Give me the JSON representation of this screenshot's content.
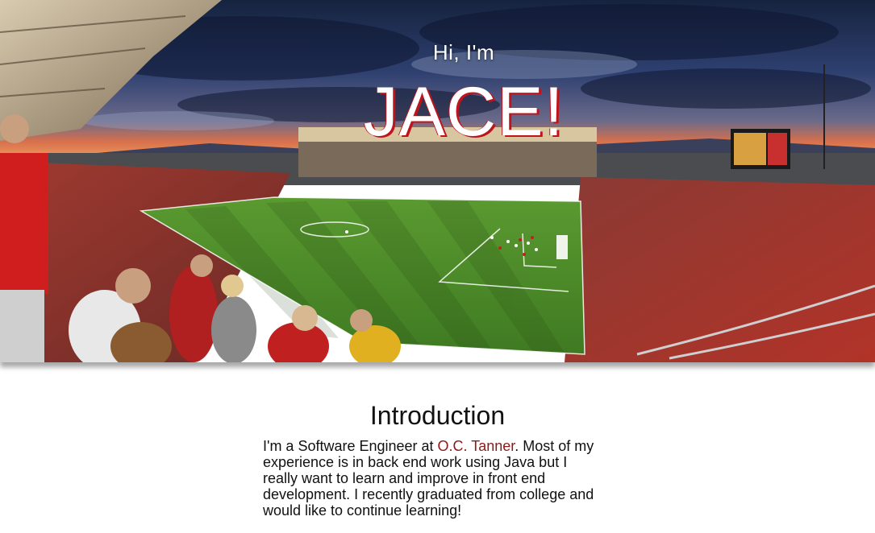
{
  "hero": {
    "greeting": "Hi, I'm",
    "name": "JACE!",
    "image_name": "stadium-panorama",
    "colors": {
      "sky_top": "#1c2a4a",
      "sunset": "#e0704a",
      "pitch": "#4f8a2c",
      "crowd": "#a4342c",
      "name_shadow": "#c0141c"
    }
  },
  "intro": {
    "title": "Introduction",
    "text_before": "I'm a Software Engineer at ",
    "link_text": "O.C. Tanner",
    "text_after": ". Most of my experience is in back end work using Java but I really want to learn and improve in front end development. I recently graduated from college and would like to continue learning!",
    "link_color": "#8b1a1a"
  }
}
